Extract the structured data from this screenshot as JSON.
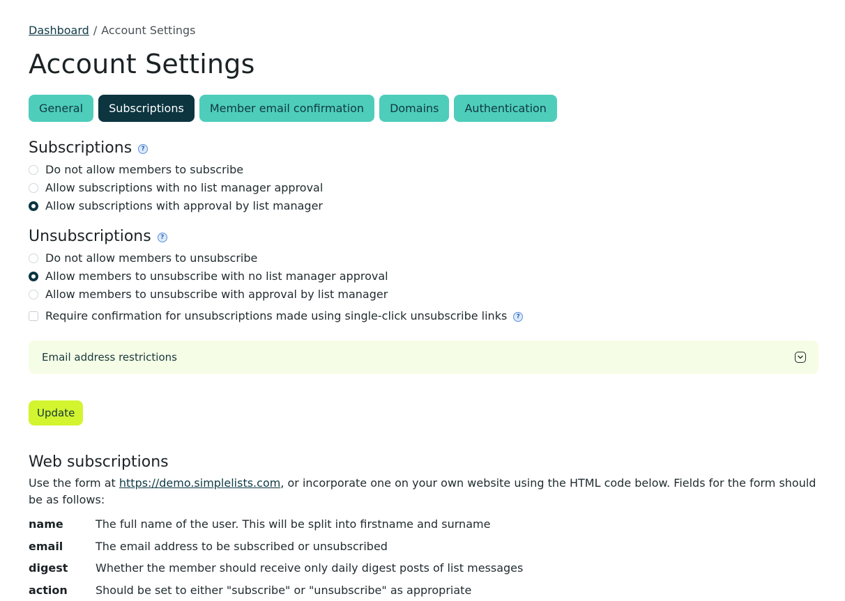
{
  "breadcrumb": {
    "link": "Dashboard",
    "separator": "/",
    "current": "Account Settings"
  },
  "page_title": "Account Settings",
  "tabs": [
    {
      "label": "General",
      "active": false
    },
    {
      "label": "Subscriptions",
      "active": true
    },
    {
      "label": "Member email confirmation",
      "active": false
    },
    {
      "label": "Domains",
      "active": false
    },
    {
      "label": "Authentication",
      "active": false
    }
  ],
  "subscriptions": {
    "heading": "Subscriptions",
    "options": [
      {
        "label": "Do not allow members to subscribe",
        "checked": false
      },
      {
        "label": "Allow subscriptions with no list manager approval",
        "checked": false
      },
      {
        "label": "Allow subscriptions with approval by list manager",
        "checked": true
      }
    ]
  },
  "unsubscriptions": {
    "heading": "Unsubscriptions",
    "options": [
      {
        "label": "Do not allow members to unsubscribe",
        "checked": false
      },
      {
        "label": "Allow members to unsubscribe with no list manager approval",
        "checked": true
      },
      {
        "label": "Allow members to unsubscribe with approval by list manager",
        "checked": false
      }
    ],
    "confirm_checkbox": {
      "label": "Require confirmation for unsubscriptions made using single-click unsubscribe links",
      "checked": false
    }
  },
  "restrictions": {
    "label": "Email address restrictions"
  },
  "update_button": "Update",
  "web_subscriptions": {
    "heading": "Web subscriptions",
    "intro_before": "Use the form at ",
    "intro_link": "https://demo.simplelists.com",
    "intro_after": ", or incorporate one on your own website using the HTML code below. Fields for the form should be as follows:",
    "fields": [
      {
        "name": "name",
        "desc": "The full name of the user. This will be split into firstname and surname"
      },
      {
        "name": "email",
        "desc": "The email address to be subscribed or unsubscribed"
      },
      {
        "name": "digest",
        "desc": "Whether the member should receive only daily digest posts of list messages"
      },
      {
        "name": "action",
        "desc": "Should be set to either \"subscribe\" or \"unsubscribe\" as appropriate"
      }
    ]
  },
  "colors": {
    "tab": "#4ecdbb",
    "tab_active": "#0c3540",
    "update_button": "#d2f52f",
    "restrictions_bg": "#f6fde6"
  },
  "icons": {
    "help": "question-circle-icon",
    "chevron": "chevron-down-icon"
  }
}
